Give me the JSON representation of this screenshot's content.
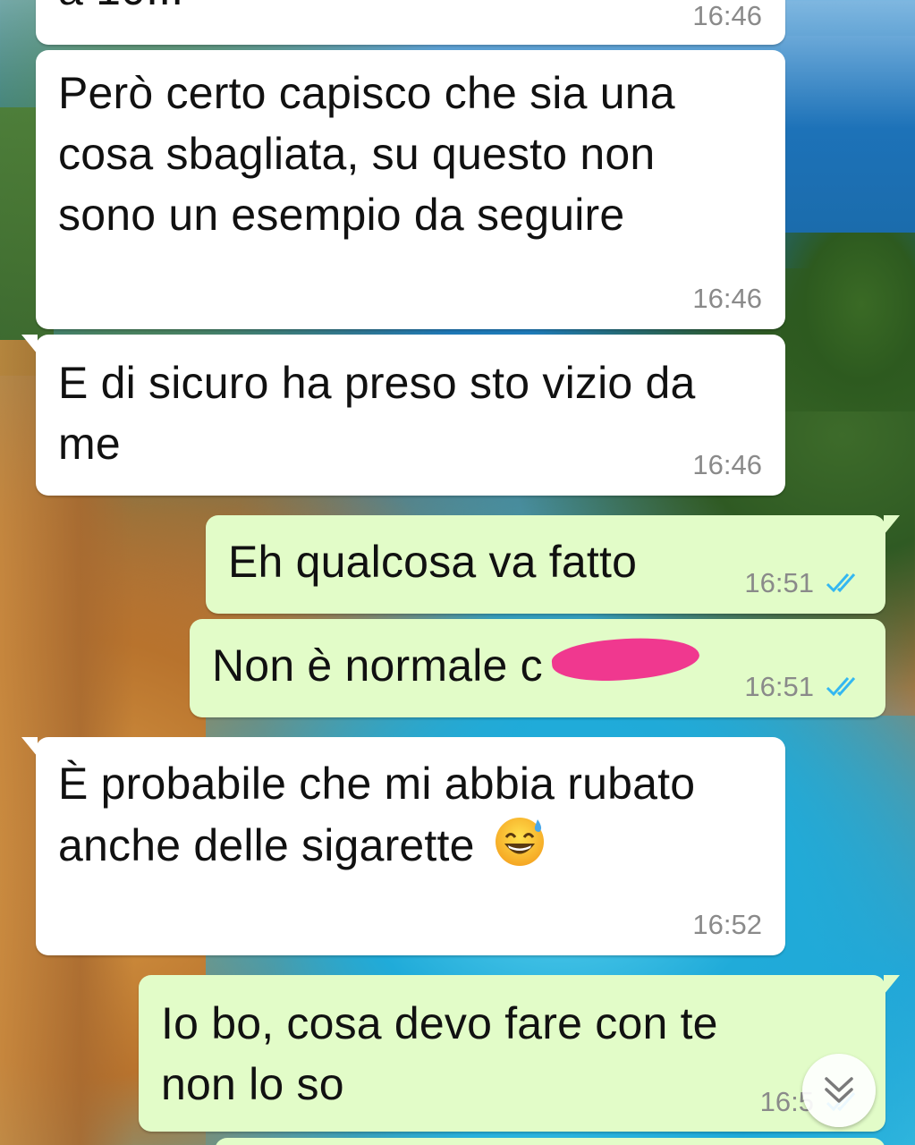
{
  "chat": {
    "messages": [
      {
        "id": "m0",
        "direction": "incoming",
        "text": "a 10...",
        "time": "16:46"
      },
      {
        "id": "m1",
        "direction": "incoming",
        "text": "Però certo capisco che sia una cosa sbagliata, su questo non sono un esempio da seguire",
        "time": "16:46"
      },
      {
        "id": "m2",
        "direction": "incoming",
        "text": "E di sicuro ha preso sto vizio da me",
        "time": "16:46"
      },
      {
        "id": "m3",
        "direction": "outgoing",
        "text": "Eh qualcosa va fatto",
        "time": "16:51",
        "status": "read"
      },
      {
        "id": "m4",
        "direction": "outgoing",
        "text": "Non è normale c",
        "time": "16:51",
        "status": "read",
        "redacted": true
      },
      {
        "id": "m5",
        "direction": "incoming",
        "text": "È probabile che mi abbia rubato anche delle sigarette",
        "emoji": "grinning-face-with-sweat",
        "time": "16:52"
      },
      {
        "id": "m6",
        "direction": "outgoing",
        "text": "Io bo, cosa devo fare con te non lo so",
        "time": "16:5",
        "status": "read"
      }
    ]
  },
  "colors": {
    "incoming_bubble": "#ffffff",
    "outgoing_bubble": "#e2fcc8",
    "read_ticks": "#34b7f1",
    "timestamp": "#8a8a8a",
    "redaction": "#f0388f"
  },
  "icons": {
    "read_receipt": "double-check-icon",
    "scroll_down": "chevron-double-down-icon"
  }
}
